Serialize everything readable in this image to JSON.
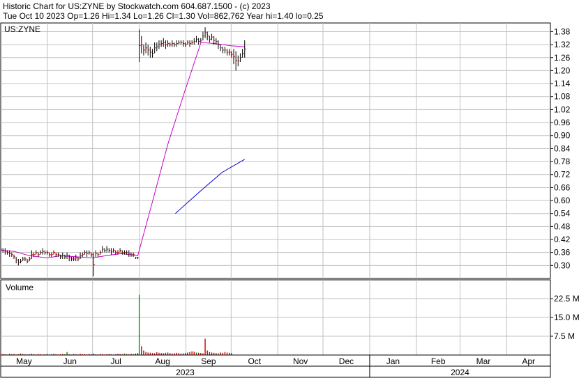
{
  "header": {
    "line1": "Historic Chart for US:ZYNE by Stockwatch.com 604.687.1500 - (c) 2023",
    "line2": "Tue Oct 10 2023  Op=1.26  Hi=1.34  Lo=1.26  Cl=1.30  Vol=862,762  Year hi=1.40  lo=0.25"
  },
  "colors": {
    "background": "#ffffff",
    "grid": "#c0c0c0",
    "frame": "#000000",
    "price_bar": "#000000",
    "price_tick": "#c00000",
    "moving_avg_1": "#cc00cc",
    "moving_avg_2": "#0000cc",
    "volume_up": "#009900",
    "volume_down": "#cc0000"
  },
  "chart_data": [
    {
      "type": "ohlc",
      "symbol_label": "US:ZYNE",
      "y_ticks": [
        "1.38",
        "1.32",
        "1.26",
        "1.20",
        "1.14",
        "1.08",
        "1.02",
        "0.96",
        "0.90",
        "0.84",
        "0.78",
        "0.72",
        "0.66",
        "0.60",
        "0.54",
        "0.48",
        "0.42",
        "0.36",
        "0.30"
      ],
      "ylim": [
        0.24,
        1.42
      ],
      "x_range": [
        "2023-05-01",
        "2024-04-30"
      ],
      "grid": true,
      "series": [
        {
          "kind": "ohlc",
          "segments": [
            {
              "from": "2023-05-01",
              "to": "2023-07-31",
              "points": [
                [
                  0.39,
                  0.36
                ],
                [
                  0.38,
                  0.36
                ],
                [
                  0.38,
                  0.35
                ],
                [
                  0.37,
                  0.35
                ],
                [
                  0.37,
                  0.34
                ],
                [
                  0.36,
                  0.34
                ],
                [
                  0.35,
                  0.33
                ],
                [
                  0.34,
                  0.31
                ],
                [
                  0.33,
                  0.3
                ],
                [
                  0.33,
                  0.31
                ],
                [
                  0.34,
                  0.32
                ],
                [
                  0.34,
                  0.32
                ],
                [
                  0.33,
                  0.31
                ],
                [
                  0.34,
                  0.32
                ],
                [
                  0.37,
                  0.33
                ],
                [
                  0.36,
                  0.34
                ],
                [
                  0.37,
                  0.35
                ],
                [
                  0.36,
                  0.34
                ],
                [
                  0.37,
                  0.35
                ],
                [
                  0.38,
                  0.35
                ],
                [
                  0.37,
                  0.35
                ],
                [
                  0.37,
                  0.35
                ],
                [
                  0.36,
                  0.34
                ],
                [
                  0.36,
                  0.34
                ],
                [
                  0.37,
                  0.35
                ],
                [
                  0.36,
                  0.34
                ],
                [
                  0.36,
                  0.34
                ],
                [
                  0.35,
                  0.33
                ],
                [
                  0.36,
                  0.33
                ],
                [
                  0.35,
                  0.33
                ],
                [
                  0.36,
                  0.33
                ],
                [
                  0.35,
                  0.32
                ],
                [
                  0.34,
                  0.32
                ],
                [
                  0.34,
                  0.32
                ],
                [
                  0.35,
                  0.32
                ],
                [
                  0.34,
                  0.32
                ],
                [
                  0.36,
                  0.33
                ],
                [
                  0.36,
                  0.34
                ],
                [
                  0.37,
                  0.35
                ],
                [
                  0.37,
                  0.34
                ],
                [
                  0.37,
                  0.35
                ],
                [
                  0.36,
                  0.34
                ],
                [
                  0.36,
                  0.25
                ],
                [
                  0.37,
                  0.34
                ],
                [
                  0.36,
                  0.34
                ],
                [
                  0.37,
                  0.35
                ],
                [
                  0.39,
                  0.36
                ],
                [
                  0.38,
                  0.36
                ],
                [
                  0.39,
                  0.36
                ],
                [
                  0.38,
                  0.36
                ],
                [
                  0.38,
                  0.35
                ],
                [
                  0.38,
                  0.36
                ],
                [
                  0.37,
                  0.35
                ],
                [
                  0.37,
                  0.35
                ],
                [
                  0.38,
                  0.36
                ],
                [
                  0.37,
                  0.35
                ],
                [
                  0.37,
                  0.35
                ],
                [
                  0.37,
                  0.35
                ],
                [
                  0.37,
                  0.34
                ],
                [
                  0.36,
                  0.34
                ],
                [
                  0.36,
                  0.34
                ],
                [
                  0.34,
                  0.33
                ],
                [
                  0.34,
                  0.33
                ]
              ]
            },
            {
              "from": "2023-08-01",
              "to": "2023-10-10",
              "points": [
                [
                  1.39,
                  1.24
                ],
                [
                  1.36,
                  1.28
                ],
                [
                  1.32,
                  1.27
                ],
                [
                  1.33,
                  1.28
                ],
                [
                  1.32,
                  1.27
                ],
                [
                  1.31,
                  1.26
                ],
                [
                  1.3,
                  1.26
                ],
                [
                  1.33,
                  1.28
                ],
                [
                  1.33,
                  1.29
                ],
                [
                  1.34,
                  1.3
                ],
                [
                  1.34,
                  1.31
                ],
                [
                  1.35,
                  1.31
                ],
                [
                  1.34,
                  1.3
                ],
                [
                  1.34,
                  1.31
                ],
                [
                  1.33,
                  1.31
                ],
                [
                  1.34,
                  1.31
                ],
                [
                  1.33,
                  1.31
                ],
                [
                  1.34,
                  1.31
                ],
                [
                  1.34,
                  1.32
                ],
                [
                  1.34,
                  1.32
                ],
                [
                  1.34,
                  1.31
                ],
                [
                  1.33,
                  1.31
                ],
                [
                  1.34,
                  1.32
                ],
                [
                  1.34,
                  1.31
                ],
                [
                  1.34,
                  1.32
                ],
                [
                  1.35,
                  1.32
                ],
                [
                  1.36,
                  1.33
                ],
                [
                  1.35,
                  1.32
                ],
                [
                  1.35,
                  1.33
                ],
                [
                  1.38,
                  1.34
                ],
                [
                  1.4,
                  1.35
                ],
                [
                  1.38,
                  1.34
                ],
                [
                  1.36,
                  1.33
                ],
                [
                  1.37,
                  1.34
                ],
                [
                  1.36,
                  1.32
                ],
                [
                  1.35,
                  1.32
                ],
                [
                  1.34,
                  1.3
                ],
                [
                  1.32,
                  1.29
                ],
                [
                  1.31,
                  1.28
                ],
                [
                  1.31,
                  1.28
                ],
                [
                  1.3,
                  1.27
                ],
                [
                  1.3,
                  1.27
                ],
                [
                  1.29,
                  1.26
                ],
                [
                  1.3,
                  1.23
                ],
                [
                  1.29,
                  1.2
                ],
                [
                  1.27,
                  1.22
                ],
                [
                  1.28,
                  1.24
                ],
                [
                  1.3,
                  1.26
                ],
                [
                  1.34,
                  1.26
                ]
              ]
            }
          ]
        },
        {
          "kind": "line",
          "color_key": "moving_avg_1",
          "points": [
            [
              "2023-05-01",
              0.37
            ],
            [
              "2023-05-10",
              0.365
            ],
            [
              "2023-05-20",
              0.345
            ],
            [
              "2023-06-01",
              0.335
            ],
            [
              "2023-06-10",
              0.345
            ],
            [
              "2023-06-20",
              0.34
            ],
            [
              "2023-07-01",
              0.335
            ],
            [
              "2023-07-10",
              0.345
            ],
            [
              "2023-07-20",
              0.355
            ],
            [
              "2023-07-31",
              0.345
            ],
            [
              "2023-08-10",
              0.6
            ],
            [
              "2023-08-20",
              0.86
            ],
            [
              "2023-08-31",
              1.1
            ],
            [
              "2023-09-11",
              1.33
            ],
            [
              "2023-09-20",
              1.325
            ],
            [
              "2023-10-01",
              1.315
            ],
            [
              "2023-10-10",
              1.31
            ]
          ]
        },
        {
          "kind": "line",
          "color_key": "moving_avg_2",
          "points": [
            [
              "2023-08-25",
              0.54
            ],
            [
              "2023-09-10",
              0.64
            ],
            [
              "2023-09-25",
              0.73
            ],
            [
              "2023-10-10",
              0.79
            ]
          ]
        }
      ]
    },
    {
      "type": "bar",
      "title": "Volume",
      "y_ticks": [
        "22.5 M",
        "15.0 M",
        "7.5 M"
      ],
      "ylim": [
        0,
        30
      ],
      "unit": "M",
      "x_range": [
        "2023-05-01",
        "2024-04-30"
      ],
      "up_day_indices": [
        10,
        30,
        56,
        60,
        89,
        99
      ],
      "values": [
        0.3,
        0.4,
        0.3,
        0.2,
        0.5,
        0.3,
        0.4,
        0.2,
        0.3,
        0.6,
        0.4,
        0.3,
        0.2,
        0.3,
        0.5,
        0.3,
        0.2,
        0.4,
        0.3,
        0.2,
        0.3,
        0.4,
        0.2,
        0.3,
        0.5,
        0.3,
        0.2,
        0.3,
        0.4,
        0.3,
        1.2,
        0.3,
        0.2,
        0.4,
        0.3,
        0.2,
        0.5,
        0.3,
        0.3,
        0.2,
        0.4,
        0.3,
        0.6,
        0.3,
        0.2,
        0.4,
        0.3,
        0.2,
        0.3,
        0.4,
        0.3,
        0.2,
        0.3,
        0.5,
        0.4,
        0.3,
        0.6,
        0.4,
        0.3,
        0.5,
        0.4,
        0.6,
        0.8,
        24.0,
        3.5,
        1.8,
        1.2,
        1.0,
        0.9,
        0.8,
        0.7,
        1.1,
        0.9,
        0.8,
        0.7,
        0.9,
        1.0,
        0.8,
        0.6,
        0.7,
        0.9,
        0.8,
        0.6,
        0.7,
        0.8,
        1.0,
        1.2,
        1.5,
        1.3,
        1.0,
        0.9,
        0.8,
        0.7,
        6.5,
        1.8,
        1.2,
        1.0,
        0.9,
        0.8,
        0.7,
        1.0,
        0.9,
        1.2,
        1.0,
        0.9,
        0.8
      ]
    }
  ],
  "x_axis": {
    "months": [
      {
        "label": "May",
        "start": "2023-05-01"
      },
      {
        "label": "Jun",
        "start": "2023-06-01"
      },
      {
        "label": "Jul",
        "start": "2023-07-01"
      },
      {
        "label": "Aug",
        "start": "2023-08-01"
      },
      {
        "label": "Sep",
        "start": "2023-09-01"
      },
      {
        "label": "Oct",
        "start": "2023-10-01"
      },
      {
        "label": "Nov",
        "start": "2023-11-01"
      },
      {
        "label": "Dec",
        "start": "2023-12-01"
      },
      {
        "label": "Jan",
        "start": "2024-01-01"
      },
      {
        "label": "Feb",
        "start": "2024-02-01"
      },
      {
        "label": "Mar",
        "start": "2024-03-01"
      },
      {
        "label": "Apr",
        "start": "2024-04-01"
      }
    ],
    "years": [
      {
        "label": "2023",
        "from": "2023-05-01",
        "to": "2023-12-31"
      },
      {
        "label": "2024",
        "from": "2024-01-01",
        "to": "2024-04-30"
      }
    ]
  }
}
